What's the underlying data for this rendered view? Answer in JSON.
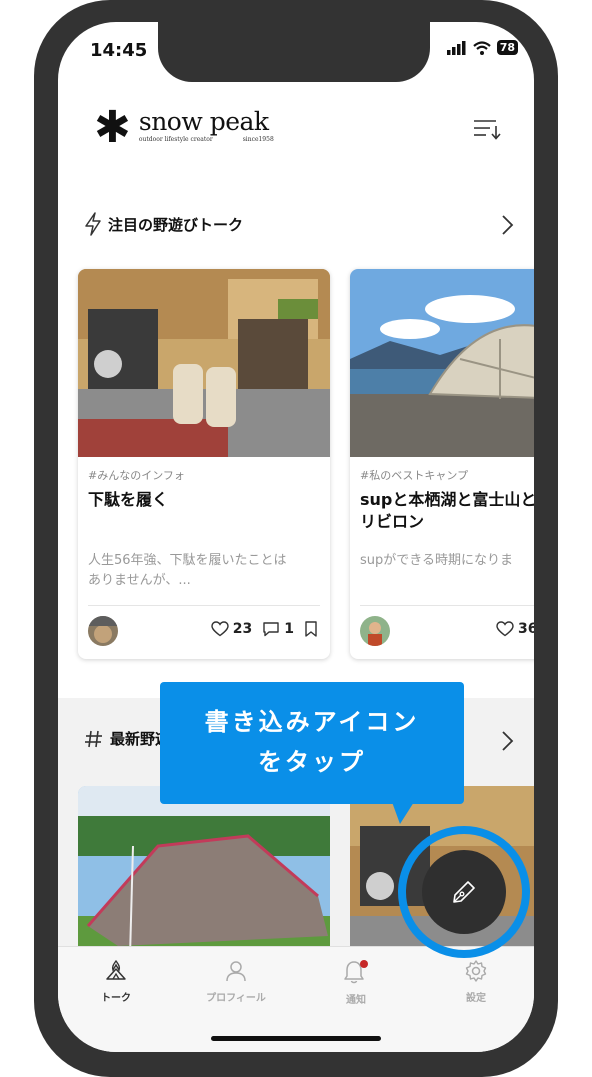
{
  "status": {
    "time": "14:45",
    "battery": "78"
  },
  "header": {
    "logo_name": "snow peak",
    "logo_sub_left": "outdoor lifestyle creator",
    "logo_sub_right": "since1958"
  },
  "featured": {
    "title": "注目の野遊びトーク",
    "cards": [
      {
        "tag": "#みんなのインフォ",
        "title": "下駄を履く",
        "excerpt": "人生56年強、下駄を履いたことは\nありませんが、...",
        "likes": "23",
        "comments": "1"
      },
      {
        "tag": "#私のベストキャンプ",
        "title": "supと本栖湖と富士山と\nリビロン",
        "excerpt": "supができる時期になりま",
        "likes": "36"
      }
    ]
  },
  "latest": {
    "title": "最新野遊"
  },
  "tooltip": {
    "text": "書き込みアイコン\nをタップ"
  },
  "tabs": [
    {
      "label": "トーク",
      "icon": "tent-icon"
    },
    {
      "label": "プロフィール",
      "icon": "person-icon"
    },
    {
      "label": "通知",
      "icon": "bell-icon"
    },
    {
      "label": "設定",
      "icon": "gear-icon"
    }
  ],
  "colors": {
    "accent": "#0a8fe8",
    "fab": "#2f2f2f",
    "frame": "#333333",
    "badge": "#c62828"
  }
}
